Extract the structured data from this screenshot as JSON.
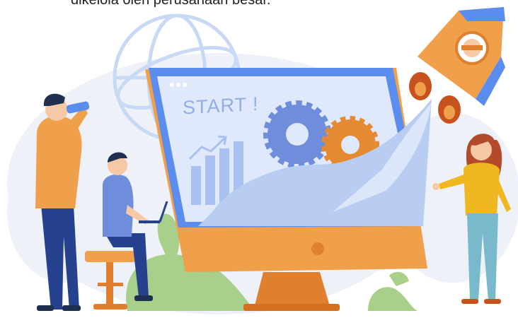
{
  "caption": "dikelola oleh perusahaan besar.",
  "screen": {
    "word": "START !"
  },
  "colors": {
    "accent": "#f0a04b",
    "monitor_frame": "#5b8def",
    "monitor_stand": "#e07f2d",
    "globe_line": "#c7d9f5",
    "blob": "#eef2f8",
    "screen_bg": "#dfe9fb",
    "screen_text": "#93aee6",
    "gear_blue": "#6e8ddb",
    "gear_orange": "#e68a32",
    "chart_bar": "#a8c1f0",
    "plant": "#a8d08a"
  },
  "icons": [
    "globe-icon",
    "rocket-icon",
    "gear-icon",
    "rising-arrow-icon"
  ],
  "people": [
    "man-with-binoculars",
    "man-with-laptop",
    "woman-presenting"
  ]
}
